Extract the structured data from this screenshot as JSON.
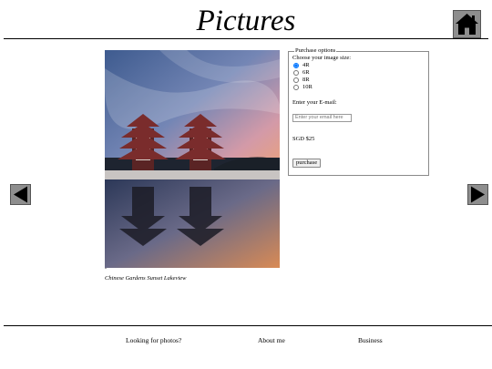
{
  "header": {
    "title": "Pictures",
    "home_icon": "home-icon"
  },
  "nav": {
    "prev_icon": "arrow-left-icon",
    "next_icon": "arrow-right-icon"
  },
  "photo": {
    "marker": "-",
    "caption": "Chinese Gardens Sunset Lakeview"
  },
  "purchase": {
    "legend": "Purchase options",
    "size_prompt": "Choose your image size:",
    "sizes": [
      "4R",
      "6R",
      "8R",
      "10R"
    ],
    "selected_size": "4R",
    "email_label": "Enter your E-mail:",
    "email_placeholder": "Enter your email here",
    "email_value": "",
    "price": "SGD $25",
    "button_label": "purchase"
  },
  "footer": {
    "links": [
      "Looking for photos?",
      "About me",
      "Business"
    ]
  },
  "colors": {
    "button_gray": "#8e8e8e",
    "border_gray": "#8a8a8a"
  }
}
